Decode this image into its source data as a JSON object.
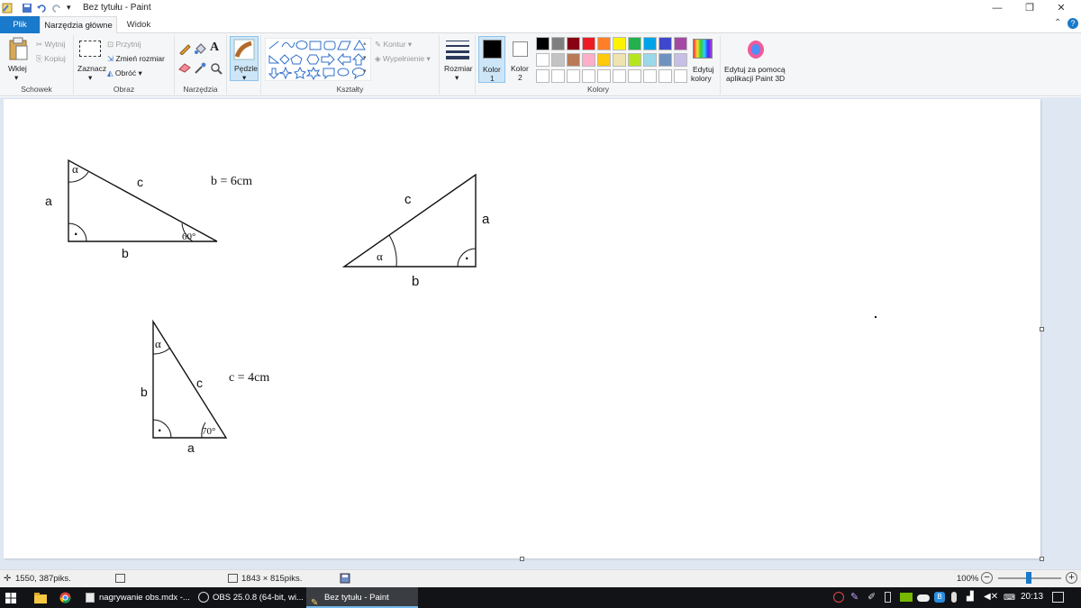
{
  "window": {
    "title": "Bez tytułu - Paint",
    "minimize": "—",
    "maximize": "❐",
    "close": "✕"
  },
  "tabs": {
    "file": "Plik",
    "home": "Narzędzia główne",
    "view": "Widok"
  },
  "ribbon": {
    "clipboard": {
      "label": "Schowek",
      "paste": "Wklej",
      "cut": "Wytnij",
      "copy": "Kopiuj"
    },
    "image": {
      "label": "Obraz",
      "select": "Zaznacz",
      "crop": "Przytnij",
      "resize": "Zmień rozmiar",
      "rotate": "Obróć"
    },
    "tools": {
      "label": "Narzędzia"
    },
    "brushes": {
      "label": "Pędzle"
    },
    "shapes": {
      "label": "Kształty",
      "outline": "Kontur",
      "fill": "Wypełnienie"
    },
    "size": {
      "label": "Rozmiar"
    },
    "colors": {
      "label": "Kolory",
      "color1_line1": "Kolor",
      "color1_line2": "1",
      "color2_line1": "Kolor",
      "color2_line2": "2",
      "edit_line1": "Edytuj",
      "edit_line2": "kolory",
      "paint3d_line1": "Edytuj za pomocą",
      "paint3d_line2": "aplikacji Paint 3D",
      "color1_value": "#000000",
      "color2_value": "#ffffff",
      "palette_row1": [
        "#000000",
        "#7f7f7f",
        "#880015",
        "#ed1c24",
        "#ff7f27",
        "#fff200",
        "#22b14c",
        "#00a2e8",
        "#3f48cc",
        "#a349a4"
      ],
      "palette_row2": [
        "#ffffff",
        "#c3c3c3",
        "#b97a57",
        "#ffaec9",
        "#ffc90e",
        "#efe4b0",
        "#b5e61d",
        "#99d9ea",
        "#7092be",
        "#c8bfe7"
      ],
      "palette_row3": [
        "#ffffff",
        "#ffffff",
        "#ffffff",
        "#ffffff",
        "#ffffff",
        "#ffffff",
        "#ffffff",
        "#ffffff",
        "#ffffff",
        "#ffffff"
      ]
    }
  },
  "drawing": {
    "t1": {
      "alpha": "α",
      "a": "a",
      "b": "b",
      "c": "c",
      "angle": "60°",
      "right_dot": "·",
      "given": "b = 6cm"
    },
    "t2": {
      "alpha": "α",
      "a": "a",
      "b": "b",
      "c": "c",
      "right_dot": "·"
    },
    "t3": {
      "alpha": "α",
      "a": "a",
      "b": "b",
      "c": "c",
      "angle": "70°",
      "right_dot": "·",
      "given": "c = 4cm"
    }
  },
  "status": {
    "cursor_position": "1550, 387piks.",
    "canvas_size": "1843 × 815piks.",
    "zoom": "100%"
  },
  "taskbar": {
    "tasks": [
      "nagrywanie obs.mdx -...",
      "OBS 25.0.8 (64-bit, wi...",
      "Bez tytułu - Paint"
    ],
    "clock": "20:13"
  }
}
